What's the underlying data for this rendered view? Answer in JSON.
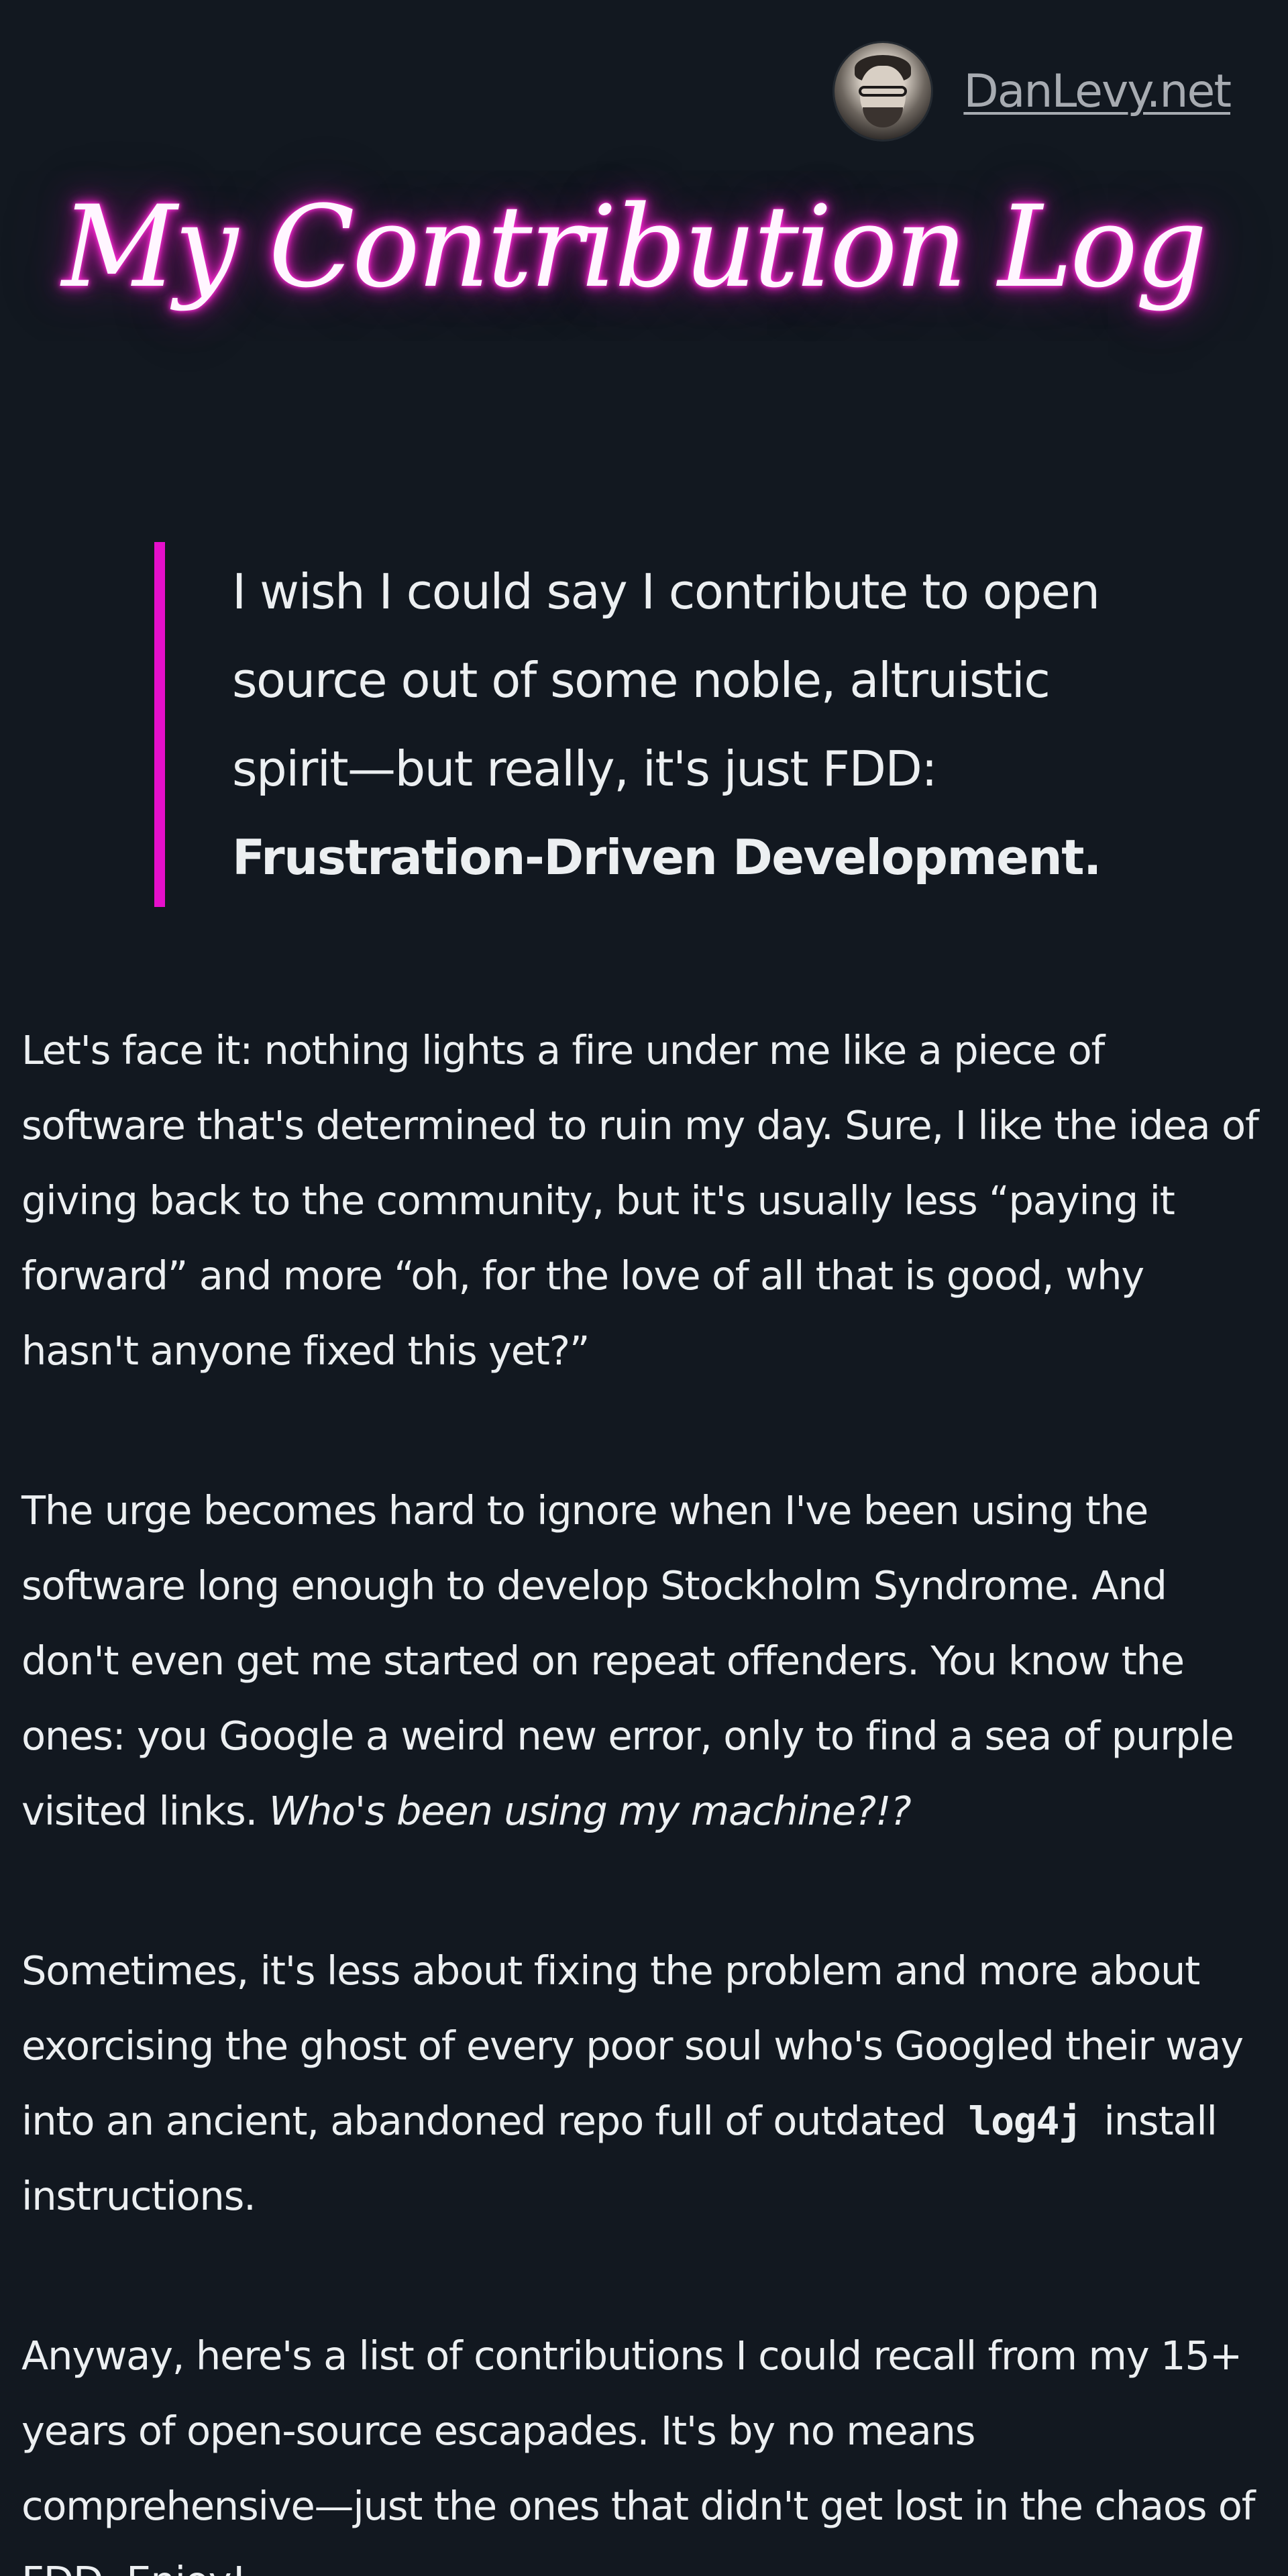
{
  "header": {
    "site_link": "DanLevy.net",
    "avatar_icon": "avatar-icon"
  },
  "hero": {
    "title": "My Contribution Log",
    "glow_color": "#ff2bd6"
  },
  "quote": {
    "text": "I wish I could say I contribute to open source out of some noble, altruistic spirit—but really, it's just FDD:",
    "emphasis": "Frustration-Driven Development.",
    "border_color": "#e60fcb"
  },
  "paragraphs": {
    "p1": "Let's face it: nothing lights a fire under me like a piece of software that's determined to ruin my day. Sure, I like the idea of giving back to the community, but it's usually less “paying it forward” and more “oh, for the love of all that is good, why hasn't anyone fixed this yet?”",
    "p2_text": "The urge becomes hard to ignore when I've been using the software long enough to develop Stockholm Syndrome. And don't even get me started on repeat offenders. You know the ones: you Google a weird new error, only to find a sea of purple visited links.",
    "p2_em": "Who's been using my machine?!?",
    "p3_text": "Sometimes, it's less about fixing the problem and more about exorcising the ghost of every poor soul who's Googled their way into an ancient, abandoned repo full of outdated",
    "p3_code": "log4j",
    "p3_tail": "install instructions.",
    "p4": "Anyway, here's a list of contributions I could recall from my 15+ years of open-source escapades. It's by no means comprehensive—just the ones that didn't get lost in the chaos of FDD. Enjoy!"
  }
}
